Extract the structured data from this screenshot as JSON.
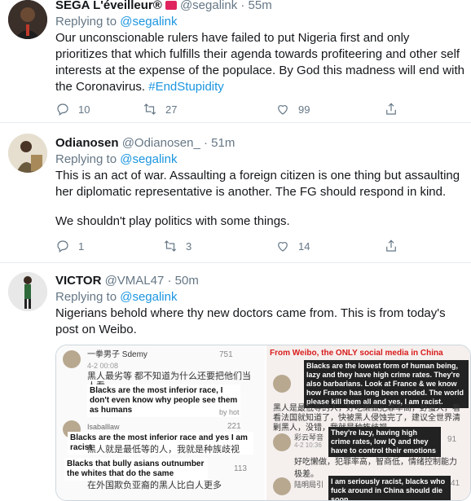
{
  "tweets": [
    {
      "name": "SEGA L'éveilleur®",
      "handle": "@segalink · 55m",
      "replying_prefix": "Replying to ",
      "replying_to": "@segalink",
      "text": "Our unconscionable rulers have failed to put Nigeria first and only prioritizes that which fulfills their agenda towards profiteering and other self interests at the expense of the populace. By God this madness will end with the Coronavirus.",
      "hashtag": "#EndStupidity",
      "replies": "10",
      "retweets": "27",
      "likes": "99"
    },
    {
      "name": "Odianosen",
      "handle": "@Odianosen_ · 51m",
      "replying_prefix": "Replying to ",
      "replying_to": "@segalink",
      "text": "This is an act of war. Assaulting a foreign citizen is one thing but assaulting her diplomatic representative is another. The FG should respond in kind.",
      "text2": "We shouldn't play politics with some things.",
      "replies": "1",
      "retweets": "3",
      "likes": "14"
    },
    {
      "name": "VICTOR",
      "handle": "@VMAL47 · 50m",
      "replying_prefix": "Replying to ",
      "replying_to": "@segalink",
      "text": "Nigerians behold where thy new doctors came from. This is from today's post on Weibo."
    }
  ],
  "media": {
    "left": {
      "user1": "一拳男子 Sdemy",
      "date1": "4-2 00:08",
      "count1": "751",
      "cn1": "黑人最劣等 都不知道为什么还要把他们当人看",
      "en1": "Blacks are the most inferior race, I don't even know why people see them as humans",
      "reply_by": "by hot",
      "user2": "Isaballlaw",
      "count2": "221",
      "en2": "Blacks are the most inferior race and yes I am racist",
      "cn2": "黑人就是最低等的人，我就是种族歧视",
      "en3": "Blacks that bully asians outnumber the whites that do the same",
      "count3": "113",
      "cn3": "在外国欺负亚裔的黑人比白人更多"
    },
    "right": {
      "title": "From Weibo, the ONLY social media in China",
      "en1": "Blacks are the lowest form of human being, lazy and they have high crime rates. They're also barbarians. Look at France & we know how France has long been eroded. The world please kill them all and yes, I am racist.",
      "cn1": "黑人是最低等的人，好吃懒做犯罪率高，野蛮人，看看法国就知道了，快被黑人侵蚀完了，建议全世界清剿黑人，没错，我就是种族歧视",
      "user2": "彩云琴音",
      "date2": "4-2 10:36",
      "en2": "They're lazy, having high crime rates, low IQ and they have to control their emotions",
      "count2": "91",
      "cn2": "好吃懒做，犯罪率高，智商低，情绪控制能力极差。",
      "user3": "陆明局引",
      "en3": "I am seriously racist, blacks who fuck around in China should die soon",
      "count3": "41"
    }
  }
}
